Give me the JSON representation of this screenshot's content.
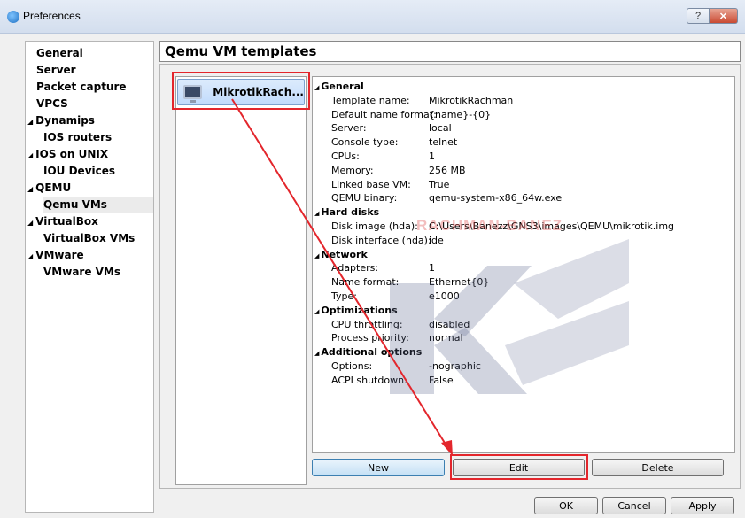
{
  "window": {
    "title": "Preferences",
    "help_label": "?",
    "close_label": "✕"
  },
  "nav": {
    "items": [
      {
        "label": "General",
        "arrow": ""
      },
      {
        "label": "Server",
        "arrow": ""
      },
      {
        "label": "Packet capture",
        "arrow": ""
      },
      {
        "label": "VPCS",
        "arrow": ""
      },
      {
        "label": "Dynamips",
        "arrow": "◢"
      },
      {
        "label": "IOS routers",
        "arrow": ""
      },
      {
        "label": "IOS on UNIX",
        "arrow": "◢"
      },
      {
        "label": "IOU Devices",
        "arrow": ""
      },
      {
        "label": "QEMU",
        "arrow": "◢"
      },
      {
        "label": "Qemu VMs",
        "arrow": ""
      },
      {
        "label": "VirtualBox",
        "arrow": "◢"
      },
      {
        "label": "VirtualBox VMs",
        "arrow": ""
      },
      {
        "label": "VMware",
        "arrow": "◢"
      },
      {
        "label": "VMware VMs",
        "arrow": ""
      }
    ]
  },
  "page_title": "Qemu VM templates",
  "vm_list": {
    "items": [
      {
        "name": "MikrotikRach..."
      }
    ]
  },
  "details": {
    "sections": [
      {
        "title": "General",
        "rows": [
          {
            "key": "Template name:",
            "value": "MikrotikRachman"
          },
          {
            "key": "Default name format:",
            "value": "{name}-{0}"
          },
          {
            "key": "Server:",
            "value": "local"
          },
          {
            "key": "Console type:",
            "value": "telnet"
          },
          {
            "key": "CPUs:",
            "value": "1"
          },
          {
            "key": "Memory:",
            "value": "256 MB"
          },
          {
            "key": "Linked base VM:",
            "value": "True"
          },
          {
            "key": "QEMU binary:",
            "value": "qemu-system-x86_64w.exe"
          }
        ]
      },
      {
        "title": "Hard disks",
        "rows": [
          {
            "key": "Disk image (hda):",
            "value": "C:\\Users\\Banezz\\GNS3\\images\\QEMU\\mikrotik.img"
          },
          {
            "key": "Disk interface (hda):",
            "value": "ide"
          }
        ]
      },
      {
        "title": "Network",
        "rows": [
          {
            "key": "Adapters:",
            "value": "1"
          },
          {
            "key": "Name format:",
            "value": "Ethernet{0}"
          },
          {
            "key": "Type:",
            "value": "e1000"
          }
        ]
      },
      {
        "title": "Optimizations",
        "rows": [
          {
            "key": "CPU throttling:",
            "value": "disabled"
          },
          {
            "key": "Process priority:",
            "value": "normal"
          }
        ]
      },
      {
        "title": "Additional options",
        "rows": [
          {
            "key": "Options:",
            "value": "-nographic"
          },
          {
            "key": "ACPI shutdown:",
            "value": "False"
          }
        ]
      }
    ]
  },
  "buttons": {
    "new": "New",
    "edit": "Edit",
    "delete": "Delete",
    "ok": "OK",
    "cancel": "Cancel",
    "apply": "Apply"
  },
  "watermark_text": "RACHMAN-BANEZ",
  "colors": {
    "annotation_red": "#e3262c",
    "selection_blue": "#c1dbfc"
  }
}
